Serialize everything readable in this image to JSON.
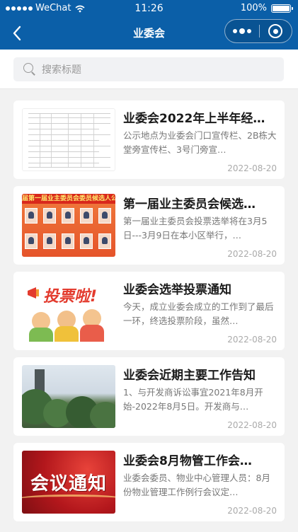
{
  "status_bar": {
    "carrier": "WeChat",
    "time": "11:26",
    "battery": "100%",
    "battery_level": 1.0
  },
  "navbar": {
    "title": "业委会",
    "back_icon": "chevron-left-icon",
    "more_icon": "more-dots-icon",
    "close_icon": "close-circle-icon"
  },
  "search": {
    "placeholder": "搜索标题",
    "icon": "search-icon"
  },
  "articles": [
    {
      "title": "业委会2022年上半年经…",
      "desc": "公示地点为业委会门口宣传栏、2B栋大堂旁宣传栏、3号门旁宣…",
      "date": "2022-08-20"
    },
    {
      "title": "第一届业主委员会候选…",
      "desc": "第一届业主委员会投票选举将在3月5日---3月9日在本小区举行，…",
      "date": "2022-08-20",
      "thumb_banner": "届第一届业主委员会委员候选人公"
    },
    {
      "title": "业委会选举投票通知",
      "desc": "今天，成立业委会成立的工作到了最后一环，终选投票阶段，虽然…",
      "date": "2022-08-20",
      "thumb_text": "投票啦!"
    },
    {
      "title": "业委会近期主要工作告知",
      "desc": "1、与开发商诉讼事宜2021年8月开始-2022年8月5日。开发商与…",
      "date": "2022-08-20"
    },
    {
      "title": "业委会8月物管工作会…",
      "desc": "业委会委员、物业中心管理人员：8月份物业管理工作例行会议定…",
      "date": "2022-08-20",
      "thumb_text": "会议通知"
    }
  ],
  "colors": {
    "header": "#0b5fa8",
    "background": "#f2f2f2",
    "card": "#ffffff"
  }
}
